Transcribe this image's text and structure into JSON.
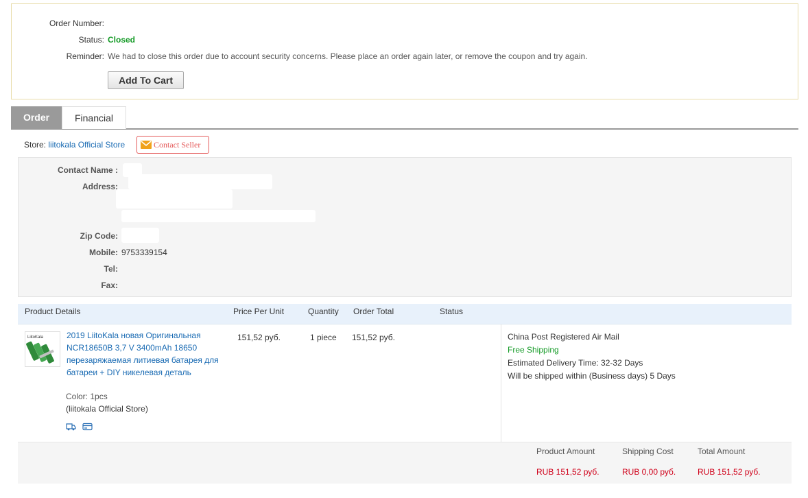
{
  "summary": {
    "order_number_label": "Order Number:",
    "order_number": "",
    "status_label": "Status:",
    "status_value": "Closed",
    "reminder_label": "Reminder:",
    "reminder_text": "We had to close this order due to account security concerns. Please place an order again later, or remove the coupon and try again.",
    "add_to_cart_label": "Add To Cart"
  },
  "tabs": [
    {
      "label": "Order",
      "active": true
    },
    {
      "label": "Financial",
      "active": false
    }
  ],
  "store": {
    "label": "Store:",
    "name": "liitokala Official Store",
    "contact_seller_label": "Contact Seller"
  },
  "contact": {
    "contact_name_label": "Contact Name :",
    "address_label": "Address:",
    "zip_label": "Zip Code:",
    "mobile_label": "Mobile:",
    "mobile": "9753339154",
    "tel_label": "Tel:",
    "fax_label": "Fax:"
  },
  "table": {
    "headers": {
      "product": "Product Details",
      "price": "Price Per Unit",
      "quantity": "Quantity",
      "order_total": "Order Total",
      "status": "Status"
    },
    "item": {
      "title": "2019 LiitoKala новая Оригинальная NCR18650B 3,7 V 3400mAh 18650 перезаряжаемая литиевая батарея для батареи + DIY никелевая деталь",
      "color": "Color: 1pcs",
      "store": "(liitokala Official Store)",
      "price": "151,52 руб.",
      "quantity": "1 piece",
      "order_total": "151,52 руб.",
      "thumb_brand": "LiitoKala"
    },
    "shipping": {
      "method": "China Post Registered Air Mail",
      "free": "Free Shipping",
      "delivery_label": "Estimated Delivery Time:",
      "delivery_value": "32-32 Days",
      "ship_within_label": "Will be shipped within (Business days)",
      "ship_within_value": "5 Days"
    }
  },
  "totals": {
    "product_amount_label": "Product Amount",
    "product_amount": "RUB 151,52 руб.",
    "shipping_cost_label": "Shipping Cost",
    "shipping_cost": "RUB 0,00 руб.",
    "total_amount_label": "Total Amount",
    "total_amount": "RUB 151,52 руб."
  },
  "colors": {
    "status_green": "#139a25",
    "link_blue": "#1a6bb3",
    "price_red": "#d0021b",
    "contact_red": "#e45757"
  },
  "icons": [
    "mail-icon",
    "truck-icon",
    "card-icon"
  ]
}
